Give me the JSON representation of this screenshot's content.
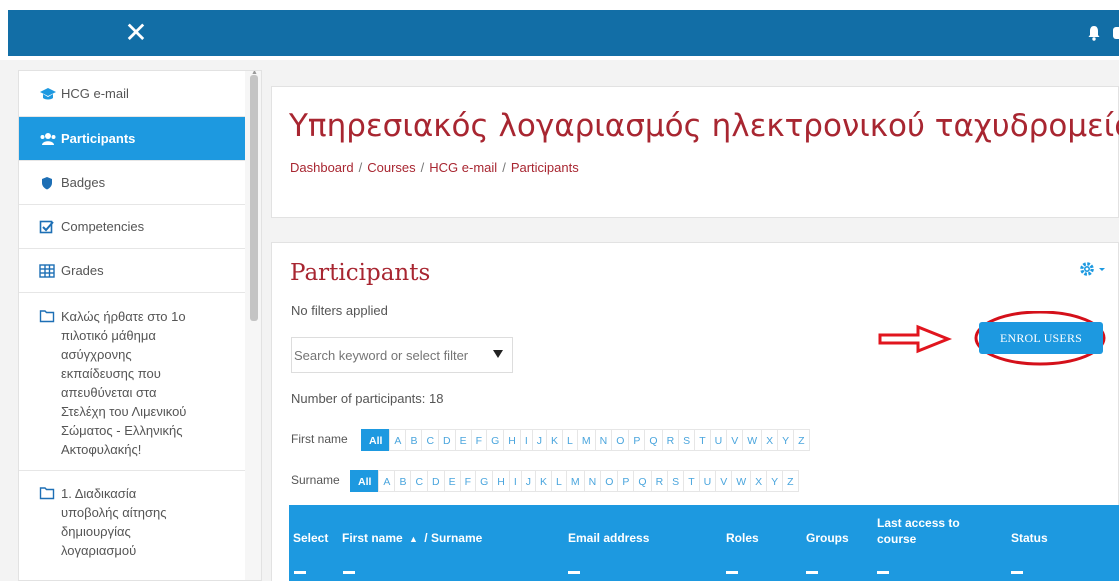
{
  "navbar": {
    "close_icon": "close-icon",
    "bell_icon": "bell-icon"
  },
  "sidebar": {
    "items": [
      {
        "label": "HCG e-mail",
        "icon": "graduation-cap-icon"
      },
      {
        "label": "Participants",
        "icon": "users-icon",
        "active": true
      },
      {
        "label": "Badges",
        "icon": "shield-icon"
      },
      {
        "label": "Competencies",
        "icon": "checkbox-icon"
      },
      {
        "label": "Grades",
        "icon": "table-icon"
      },
      {
        "lines": [
          "Καλώς ήρθατε στο 1ο",
          "πιλοτικό μάθημα",
          "ασύγχρονης",
          "εκπαίδευσης που",
          "απευθύνεται στα",
          "Στελέχη του Λιμενικού",
          "Σώματος - Ελληνικής",
          "Ακτοφυλακής!"
        ],
        "icon": "folder-icon"
      },
      {
        "lines": [
          "1. Διαδικασία",
          "υποβολής αίτησης",
          "δημιουργίας",
          "λογαριασμού"
        ],
        "icon": "folder-icon"
      }
    ]
  },
  "header": {
    "title": "Υπηρεσιακός λογαριασμός ηλεκτρονικού ταχυδρομείου",
    "breadcrumb": [
      "Dashboard",
      "Courses",
      "HCG e-mail",
      "Participants"
    ],
    "separator": "/"
  },
  "participants": {
    "heading": "Participants",
    "no_filters": "No filters applied",
    "search_placeholder": "Search keyword or select filter",
    "count_text": "Number of participants: 18",
    "enrol_button": "ENROL USERS",
    "first_name_label": "First name",
    "surname_label": "Surname",
    "all_label": "All",
    "letters": [
      "A",
      "B",
      "C",
      "D",
      "E",
      "F",
      "G",
      "H",
      "I",
      "J",
      "K",
      "L",
      "M",
      "N",
      "O",
      "P",
      "Q",
      "R",
      "S",
      "T",
      "U",
      "V",
      "W",
      "X",
      "Y",
      "Z"
    ],
    "columns": {
      "select": "Select",
      "name": "First name",
      "sort_icon": "sort-asc-icon",
      "name_sep": "/ Surname",
      "email": "Email address",
      "roles": "Roles",
      "groups": "Groups",
      "last_access_1": "Last access to",
      "last_access_2": "course",
      "status": "Status"
    }
  },
  "colors": {
    "brand": "#126ea6",
    "accent": "#1d99e0",
    "title": "#a82631",
    "annotation": "#e1151e"
  }
}
